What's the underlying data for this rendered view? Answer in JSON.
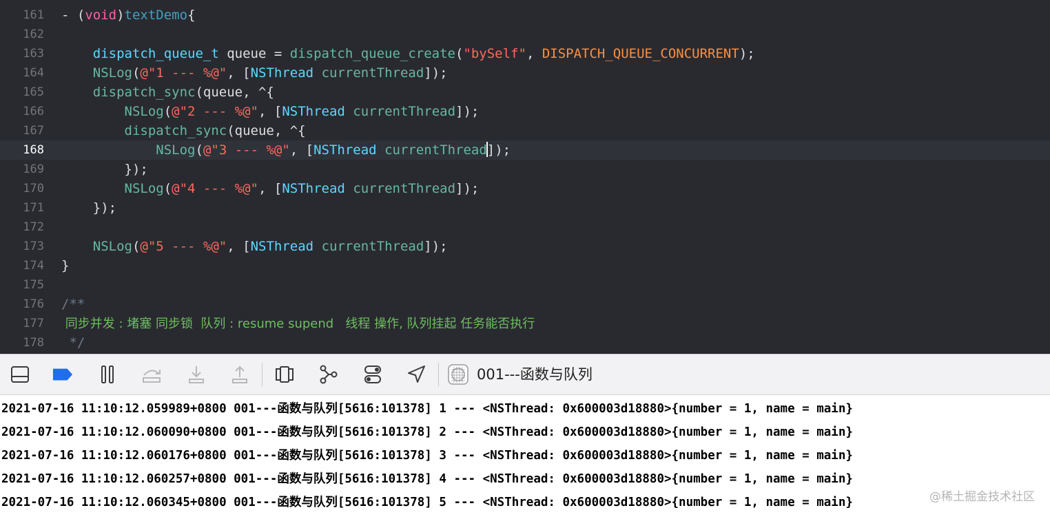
{
  "editor": {
    "current_line": "168",
    "lines": [
      {
        "num": "161",
        "segments": [
          {
            "t": "- ("
          },
          {
            "t": "void",
            "c": "kw"
          },
          {
            "t": ")"
          },
          {
            "t": "textDemo",
            "c": "decl"
          },
          {
            "t": "{"
          }
        ]
      },
      {
        "num": "162",
        "segments": []
      },
      {
        "num": "163",
        "segments": [
          {
            "t": "    "
          },
          {
            "t": "dispatch_queue_t",
            "c": "type"
          },
          {
            "t": " queue = "
          },
          {
            "t": "dispatch_queue_create",
            "c": "fn"
          },
          {
            "t": "("
          },
          {
            "t": "\"bySelf\"",
            "c": "str"
          },
          {
            "t": ", "
          },
          {
            "t": "DISPATCH_QUEUE_CONCURRENT",
            "c": "mac"
          },
          {
            "t": ");"
          }
        ]
      },
      {
        "num": "164",
        "segments": [
          {
            "t": "    "
          },
          {
            "t": "NSLog",
            "c": "fn"
          },
          {
            "t": "("
          },
          {
            "t": "@\"1 --- %@\"",
            "c": "str"
          },
          {
            "t": ", ["
          },
          {
            "t": "NSThread",
            "c": "cls"
          },
          {
            "t": " "
          },
          {
            "t": "currentThread",
            "c": "fn"
          },
          {
            "t": "]);"
          }
        ]
      },
      {
        "num": "165",
        "segments": [
          {
            "t": "    "
          },
          {
            "t": "dispatch_sync",
            "c": "fn"
          },
          {
            "t": "(queue, ^{"
          }
        ]
      },
      {
        "num": "166",
        "segments": [
          {
            "t": "        "
          },
          {
            "t": "NSLog",
            "c": "fn"
          },
          {
            "t": "("
          },
          {
            "t": "@\"2 --- %@\"",
            "c": "str"
          },
          {
            "t": ", ["
          },
          {
            "t": "NSThread",
            "c": "cls"
          },
          {
            "t": " "
          },
          {
            "t": "currentThread",
            "c": "fn"
          },
          {
            "t": "]);"
          }
        ]
      },
      {
        "num": "167",
        "segments": [
          {
            "t": "        "
          },
          {
            "t": "dispatch_sync",
            "c": "fn"
          },
          {
            "t": "(queue, ^{"
          }
        ]
      },
      {
        "num": "168",
        "segments": [
          {
            "t": "            "
          },
          {
            "t": "NSLog",
            "c": "fn"
          },
          {
            "t": "("
          },
          {
            "t": "@\"3 --- %@\"",
            "c": "str"
          },
          {
            "t": ", ["
          },
          {
            "t": "NSThread",
            "c": "cls"
          },
          {
            "t": " "
          },
          {
            "t": "currentThread",
            "c": "fn"
          },
          {
            "t": "",
            "caret": true
          },
          {
            "t": "]);"
          }
        ]
      },
      {
        "num": "169",
        "segments": [
          {
            "t": "        });"
          }
        ]
      },
      {
        "num": "170",
        "segments": [
          {
            "t": "        "
          },
          {
            "t": "NSLog",
            "c": "fn"
          },
          {
            "t": "("
          },
          {
            "t": "@\"4 --- %@\"",
            "c": "str"
          },
          {
            "t": ", ["
          },
          {
            "t": "NSThread",
            "c": "cls"
          },
          {
            "t": " "
          },
          {
            "t": "currentThread",
            "c": "fn"
          },
          {
            "t": "]);"
          }
        ]
      },
      {
        "num": "171",
        "segments": [
          {
            "t": "    });"
          }
        ]
      },
      {
        "num": "172",
        "segments": []
      },
      {
        "num": "173",
        "segments": [
          {
            "t": "    "
          },
          {
            "t": "NSLog",
            "c": "fn"
          },
          {
            "t": "("
          },
          {
            "t": "@\"5 --- %@\"",
            "c": "str"
          },
          {
            "t": ", ["
          },
          {
            "t": "NSThread",
            "c": "cls"
          },
          {
            "t": " "
          },
          {
            "t": "currentThread",
            "c": "fn"
          },
          {
            "t": "]);"
          }
        ]
      },
      {
        "num": "174",
        "segments": [
          {
            "t": "}"
          }
        ]
      },
      {
        "num": "175",
        "segments": []
      },
      {
        "num": "176",
        "segments": [
          {
            "t": "/**",
            "c": "cmt"
          }
        ]
      },
      {
        "num": "177",
        "segments": [
          {
            "t": " 同步并发 : 堵塞 同步锁  队列 : resume supend   线程 操作, 队列挂起 任务能否执行",
            "c": "doc"
          }
        ]
      },
      {
        "num": "178",
        "segments": [
          {
            "t": " */",
            "c": "cmt"
          }
        ]
      }
    ]
  },
  "debug_bar": {
    "target_label": "001---函数与队列",
    "buttons": [
      {
        "name": "hide-debug-area-button",
        "icon": "panel-bottom-icon"
      },
      {
        "name": "breakpoints-toggle-button",
        "icon": "breakpoint-icon"
      },
      {
        "name": "pause-button",
        "icon": "pause-icon"
      },
      {
        "name": "step-over-button",
        "icon": "step-over-icon"
      },
      {
        "name": "step-into-button",
        "icon": "step-into-icon"
      },
      {
        "name": "step-out-button",
        "icon": "step-out-icon"
      },
      {
        "name": "view-debugger-button",
        "icon": "view-hierarchy-icon"
      },
      {
        "name": "memory-graph-button",
        "icon": "memory-graph-icon"
      },
      {
        "name": "environment-overrides-button",
        "icon": "toggles-icon"
      },
      {
        "name": "simulate-location-button",
        "icon": "location-arrow-icon"
      }
    ],
    "colors": {
      "breakpoint_active": "#1f6feb",
      "disabled": "#b8b8bc",
      "icon": "#3a3a3c"
    }
  },
  "console": {
    "lines": [
      "2021-07-16 11:10:12.059989+0800 001---函数与队列[5616:101378] 1 --- <NSThread: 0x600003d18880>{number = 1, name = main}",
      "2021-07-16 11:10:12.060090+0800 001---函数与队列[5616:101378] 2 --- <NSThread: 0x600003d18880>{number = 1, name = main}",
      "2021-07-16 11:10:12.060176+0800 001---函数与队列[5616:101378] 3 --- <NSThread: 0x600003d18880>{number = 1, name = main}",
      "2021-07-16 11:10:12.060257+0800 001---函数与队列[5616:101378] 4 --- <NSThread: 0x600003d18880>{number = 1, name = main}",
      "2021-07-16 11:10:12.060345+0800 001---函数与队列[5616:101378] 5 --- <NSThread: 0x600003d18880>{number = 1, name = main}"
    ],
    "watermark": "@稀土掘金技术社区"
  }
}
